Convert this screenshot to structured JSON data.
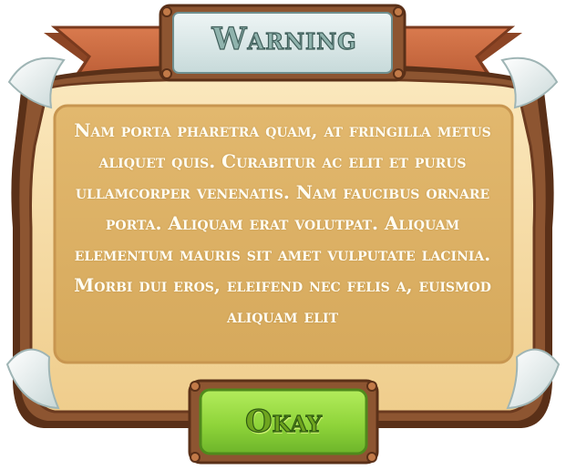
{
  "dialog": {
    "title": "Warning",
    "message": "Nam porta pharetra quam, at fringilla metus aliquet quis. Curabitur ac elit et purus ullamcorper venenatis. Nam faucibus ornare porta. Aliquam erat volutpat. Aliquam elementum mauris sit amet vulputate lacinia. Morbi dui eros, eleifend nec felis a, euismod aliquam elit",
    "ok_label": "Okay"
  },
  "colors": {
    "board_outer": "#7a4a2c",
    "board_parchment": "#f6d9a0",
    "board_inner": "#d9b06b",
    "ribbon": "#c9683f",
    "title_plate": "#d9e7e7",
    "button_green": "#8fd43a"
  },
  "icons": {
    "corner_leaf": "leaf-corner-icon"
  }
}
